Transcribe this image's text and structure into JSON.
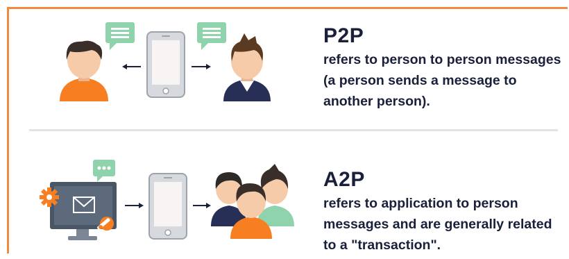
{
  "sections": [
    {
      "title": "P2P",
      "description": "refers to person to person messages (a person sends a message to another person)."
    },
    {
      "title": "A2P",
      "description": "refers to application to person messages and are generally related to a \"transaction\"."
    }
  ],
  "colors": {
    "border": "#f08a3c",
    "text": "#1a1f3a",
    "divider": "#e2e3e6",
    "phone_outline": "#9ea3ab",
    "phone_screen": "#f8f4f3",
    "chat_bubble": "#8fd3ad",
    "skin": "#f6cba9",
    "hair": "#3a2e2a",
    "shirt_orange": "#f77f21",
    "shirt_navy": "#272f56",
    "shirt_green": "#8fd3ad",
    "monitor": "#4a5566"
  },
  "icons": [
    "chat-bubble-icon",
    "phone-icon",
    "person-icon",
    "monitor-icon",
    "envelope-icon",
    "gear-icon",
    "wrench-icon",
    "arrow-icon"
  ]
}
